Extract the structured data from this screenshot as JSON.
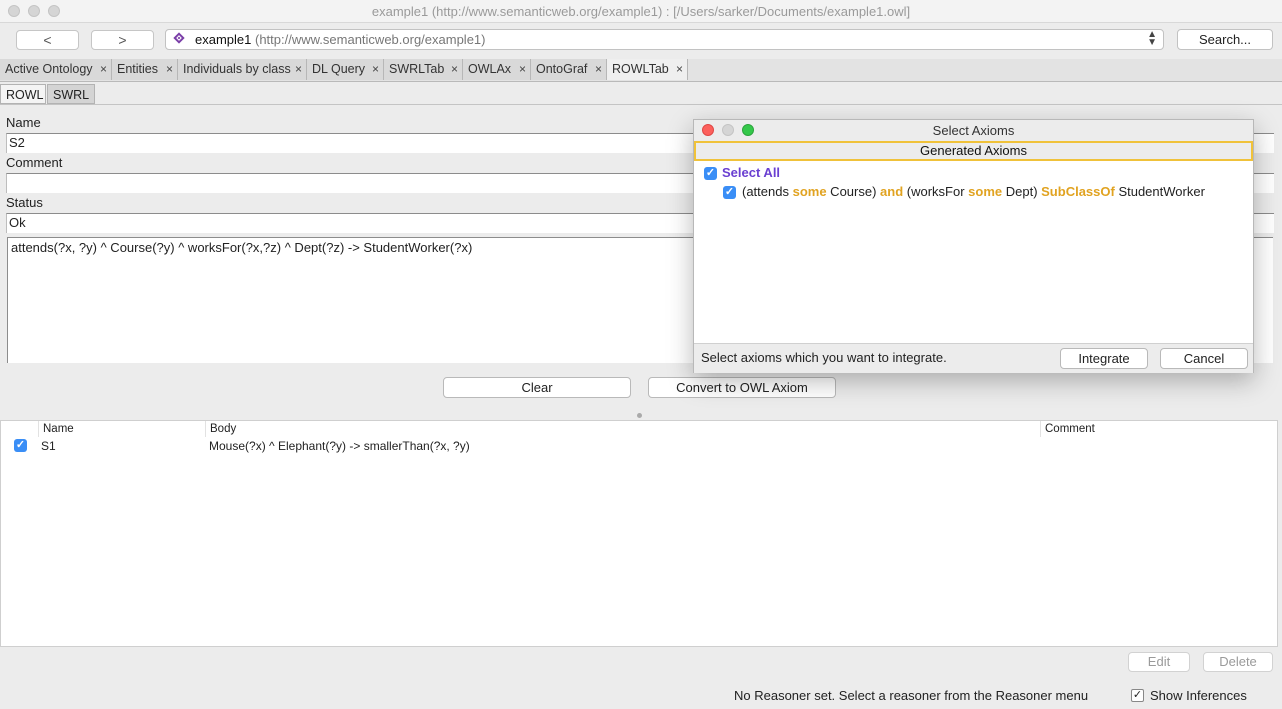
{
  "window": {
    "title": "example1 (http://www.semanticweb.org/example1)  : [/Users/sarker/Documents/example1.owl]"
  },
  "nav": {
    "back_label": "<",
    "forward_label": ">",
    "ontology_name": "example1",
    "ontology_url": "(http://www.semanticweb.org/example1)",
    "search_label": "Search..."
  },
  "tabs": [
    {
      "label": "Active Ontology"
    },
    {
      "label": "Entities"
    },
    {
      "label": "Individuals by class"
    },
    {
      "label": "DL Query"
    },
    {
      "label": "SWRLTab"
    },
    {
      "label": "OWLAx"
    },
    {
      "label": "OntoGraf"
    },
    {
      "label": "ROWLTab"
    }
  ],
  "tab_close": "×",
  "subtabs": [
    {
      "label": "ROWL"
    },
    {
      "label": "SWRL"
    }
  ],
  "form": {
    "name_label": "Name",
    "name_value": "S2",
    "comment_label": "Comment",
    "comment_value": "",
    "status_label": "Status",
    "status_value": "Ok",
    "rule_text": "attends(?x, ?y) ^ Course(?y) ^ worksFor(?x,?z) ^ Dept(?z) -> StudentWorker(?x)",
    "clear_label": "Clear",
    "convert_label": "Convert to OWL Axiom"
  },
  "table": {
    "columns": [
      "Name",
      "Body",
      "Comment"
    ],
    "rows": [
      {
        "name": "S1",
        "body": "Mouse(?x) ^ Elephant(?y) -> smallerThan(?x, ?y)",
        "comment": "",
        "checked": true
      }
    ],
    "edit_label": "Edit",
    "delete_label": "Delete"
  },
  "status": {
    "message": "No Reasoner set. Select a reasoner from the Reasoner menu",
    "show_inferences_label": "Show Inferences",
    "show_inferences_checked": true
  },
  "dialog": {
    "title": "Select Axioms",
    "header": "Generated Axioms",
    "select_all_label": "Select All",
    "axiom": {
      "open1": "(attends ",
      "kw_some1": "some",
      "course": " Course) ",
      "kw_and": "and",
      "open2": " (worksFor ",
      "kw_some2": "some",
      "dept": " Dept) ",
      "kw_subclass": "SubClassOf",
      "target": " StudentWorker"
    },
    "footer_text": "Select axioms which you want to integrate.",
    "integrate_label": "Integrate",
    "cancel_label": "Cancel"
  },
  "colors": {
    "keyword": "#e1a321",
    "select_all": "#6a3fd1",
    "checkbox": "#3a8ef6",
    "highlight_border": "#f0c23a"
  }
}
